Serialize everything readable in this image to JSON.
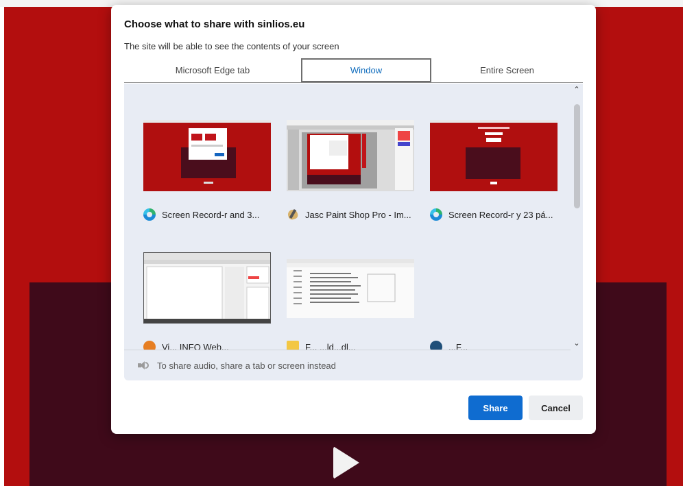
{
  "dialog": {
    "title": "Choose what to share with sinlios.eu",
    "subtitle": "The site will be able to see the contents of your screen"
  },
  "tabs": [
    {
      "label": "Microsoft Edge tab",
      "selected": false
    },
    {
      "label": "Window",
      "selected": true
    },
    {
      "label": "Entire Screen",
      "selected": false
    }
  ],
  "windows": [
    {
      "label": "Screen Record-r and 3...",
      "icon": "edge-icon"
    },
    {
      "label": "Jasc Paint Shop Pro - Im...",
      "icon": "paint-shop-pro-icon"
    },
    {
      "label": "Screen Record-r y 23 pá...",
      "icon": "edge-icon"
    },
    {
      "label": "",
      "icon": "window-thumbnail"
    },
    {
      "label": "",
      "icon": "spreadsheet-thumbnail"
    }
  ],
  "partial_row": [
    {
      "label": "Vi... INFO Web...",
      "icon": "vlc-icon"
    },
    {
      "label": "F... ...ld...dl...",
      "icon": "folder-icon"
    },
    {
      "label": "...F...",
      "icon": "edge-dark-icon"
    }
  ],
  "audio_note": "To share audio, share a tab or screen instead",
  "buttons": {
    "share": "Share",
    "cancel": "Cancel"
  },
  "colors": {
    "accent": "#0f6cd0",
    "background_red": "#b30e0e",
    "background_dark": "#3f0a1a",
    "panel": "#e8ecf4"
  }
}
